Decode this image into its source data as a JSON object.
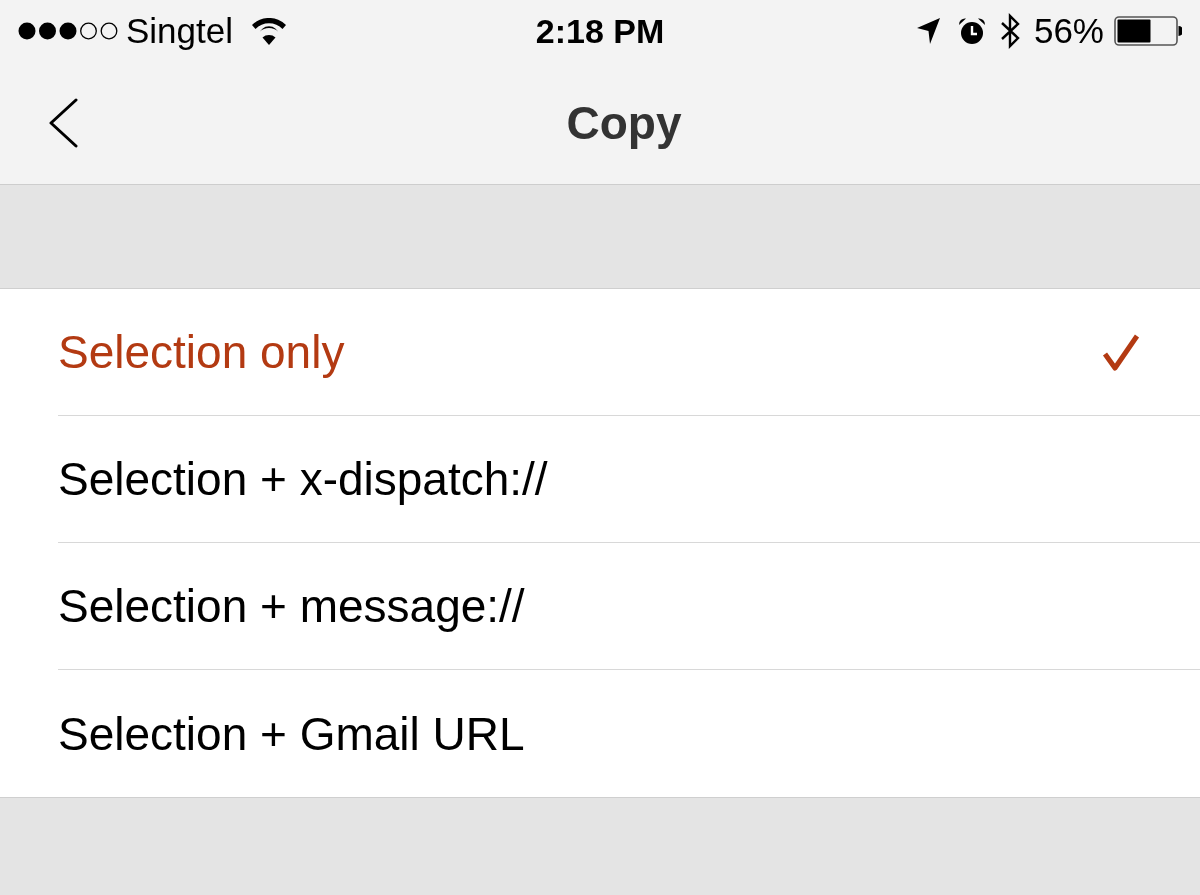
{
  "status_bar": {
    "carrier": "Singtel",
    "time": "2:18 PM",
    "battery_percent": "56%"
  },
  "nav_bar": {
    "title": "Copy"
  },
  "options": [
    {
      "label": "Selection only",
      "selected": true
    },
    {
      "label": "Selection + x-dispatch://",
      "selected": false
    },
    {
      "label": "Selection + message://",
      "selected": false
    },
    {
      "label": "Selection + Gmail URL",
      "selected": false
    }
  ]
}
